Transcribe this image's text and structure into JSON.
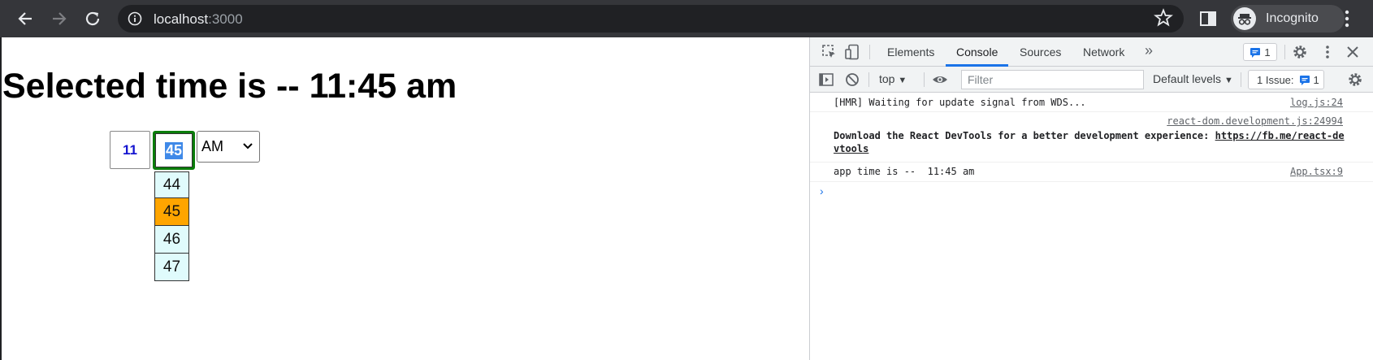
{
  "browser": {
    "url_host": "localhost",
    "url_port": ":3000",
    "profile_label": "Incognito",
    "icons": [
      "back-icon",
      "forward-icon",
      "reload-icon",
      "info-icon",
      "star-icon",
      "side-panel-icon",
      "incognito-icon",
      "more-icon"
    ]
  },
  "page": {
    "heading": "Selected time is -- 11:45 am",
    "hour_value": "11",
    "minute_value": "45",
    "ampm_value": "AM",
    "minute_options": [
      {
        "label": "44",
        "selected": false
      },
      {
        "label": "45",
        "selected": true
      },
      {
        "label": "46",
        "selected": false
      },
      {
        "label": "47",
        "selected": false
      }
    ],
    "colors": {
      "selected_option": "#ffa500",
      "option_bg": "#e0fbfc",
      "focus_border": "#0a7d0a",
      "hour_text": "#1515d0"
    }
  },
  "devtools": {
    "tabs": [
      {
        "label": "Elements",
        "active": false
      },
      {
        "label": "Console",
        "active": true
      },
      {
        "label": "Sources",
        "active": false
      },
      {
        "label": "Network",
        "active": false
      }
    ],
    "more_tabs": "»",
    "messages_badge": "1",
    "context": "top",
    "filter_placeholder": "Filter",
    "levels": "Default levels",
    "issues_label": "1 Issue:",
    "issues_count": "1",
    "logs": [
      {
        "message": "[HMR] Waiting for update signal from WDS...",
        "source": "log.js:24"
      },
      {
        "message": "Download the React DevTools for a better development experience: ",
        "link": "https://fb.me/react-devtools",
        "source": "react-dom.development.js:24994"
      },
      {
        "message": "app time is --  11:45 am",
        "source": "App.tsx:9"
      }
    ],
    "prompt": "›"
  }
}
